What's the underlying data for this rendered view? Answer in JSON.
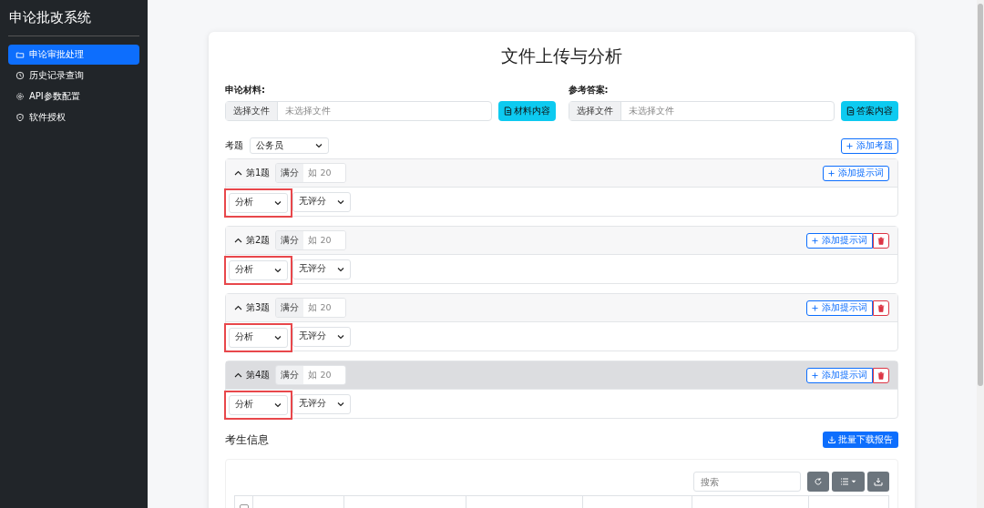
{
  "sidebar": {
    "title": "申论批改系统",
    "items": [
      {
        "label": "申论审批处理",
        "selected": true
      },
      {
        "label": "历史记录查询",
        "selected": false
      },
      {
        "label": "API参数配置",
        "selected": false
      },
      {
        "label": "软件授权",
        "selected": false
      }
    ]
  },
  "page_title": "文件上传与分析",
  "uploads": [
    {
      "label": "申论材料:",
      "choose": "选择文件",
      "placeholder": "未选择文件",
      "button": "材料内容"
    },
    {
      "label": "参考答案:",
      "choose": "选择文件",
      "placeholder": "未选择文件",
      "button": "答案内容"
    }
  ],
  "exam": {
    "label": "考题",
    "value": "公务员",
    "add_button": "添加考题"
  },
  "questions": [
    {
      "title": "第1题",
      "score_label": "满分",
      "score_placeholder": "如 20",
      "add_button": "添加提示词",
      "deletable": false,
      "hovered": false,
      "expanded": true,
      "type": "分析",
      "grading": "无评分",
      "highlighted": true
    },
    {
      "title": "第2题",
      "score_label": "满分",
      "score_placeholder": "如 20",
      "add_button": "添加提示词",
      "deletable": true,
      "hovered": false,
      "expanded": true,
      "type": "分析",
      "grading": "无评分",
      "highlighted": true
    },
    {
      "title": "第3题",
      "score_label": "满分",
      "score_placeholder": "如 20",
      "add_button": "添加提示词",
      "deletable": true,
      "hovered": false,
      "expanded": true,
      "type": "分析",
      "grading": "无评分",
      "highlighted": true
    },
    {
      "title": "第4题",
      "score_label": "满分",
      "score_placeholder": "如 20",
      "add_button": "添加提示词",
      "deletable": true,
      "hovered": true,
      "expanded": true,
      "type": "分析",
      "grading": "无评分",
      "highlighted": true
    }
  ],
  "students": {
    "title": "考生信息",
    "download_button": "批量下载报告",
    "search_placeholder": "搜索",
    "select_all_checked": false
  }
}
